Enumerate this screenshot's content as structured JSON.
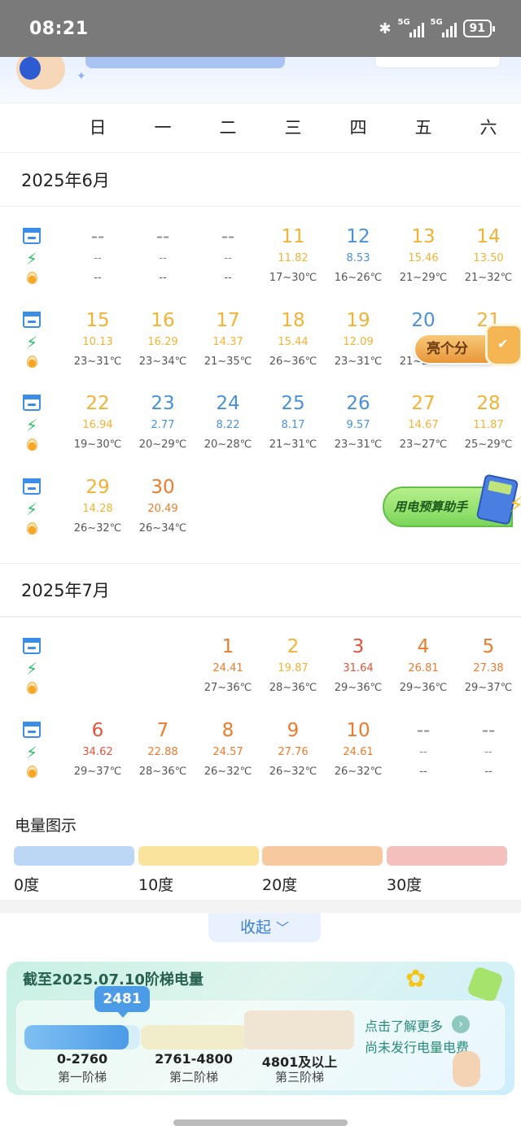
{
  "status_bar": {
    "time": "08:21",
    "network1": "5G",
    "network2": "5G",
    "battery": "91"
  },
  "weekdays": [
    "日",
    "一",
    "二",
    "三",
    "四",
    "五",
    "六"
  ],
  "months": [
    {
      "label": "2025年6月",
      "rows": [
        [
          null,
          {
            "day": "--",
            "value": "--",
            "temp": "--",
            "color": "gray"
          },
          {
            "day": "--",
            "value": "--",
            "temp": "--",
            "color": "gray"
          },
          {
            "day": "--",
            "value": "--",
            "temp": "--",
            "color": "gray"
          },
          {
            "day": "11",
            "value": "11.82",
            "temp": "17~30℃",
            "color": "yellow"
          },
          {
            "day": "12",
            "value": "8.53",
            "temp": "16~26℃",
            "color": "blue"
          },
          {
            "day": "13",
            "value": "15.46",
            "temp": "21~29℃",
            "color": "yellow"
          },
          {
            "day": "14",
            "value": "13.50",
            "temp": "21~32℃",
            "color": "yellow"
          }
        ],
        [
          null,
          {
            "day": "15",
            "value": "10.13",
            "temp": "23~31℃",
            "color": "yellow"
          },
          {
            "day": "16",
            "value": "16.29",
            "temp": "23~34℃",
            "color": "yellow"
          },
          {
            "day": "17",
            "value": "14.37",
            "temp": "21~35℃",
            "color": "yellow"
          },
          {
            "day": "18",
            "value": "15.44",
            "temp": "26~36℃",
            "color": "yellow"
          },
          {
            "day": "19",
            "value": "12.09",
            "temp": "23~31℃",
            "color": "yellow"
          },
          {
            "day": "20",
            "value": "",
            "temp": "21~26℃",
            "color": "blue"
          },
          {
            "day": "21",
            "value": "",
            "temp": "",
            "color": "yellow"
          }
        ],
        [
          null,
          {
            "day": "22",
            "value": "16.94",
            "temp": "19~30℃",
            "color": "yellow"
          },
          {
            "day": "23",
            "value": "2.77",
            "temp": "20~29℃",
            "color": "blue"
          },
          {
            "day": "24",
            "value": "8.22",
            "temp": "20~28℃",
            "color": "blue"
          },
          {
            "day": "25",
            "value": "8.17",
            "temp": "21~31℃",
            "color": "blue"
          },
          {
            "day": "26",
            "value": "9.57",
            "temp": "23~31℃",
            "color": "blue"
          },
          {
            "day": "27",
            "value": "14.67",
            "temp": "23~27℃",
            "color": "yellow"
          },
          {
            "day": "28",
            "value": "11.87",
            "temp": "25~29℃",
            "color": "yellow"
          }
        ],
        [
          null,
          {
            "day": "29",
            "value": "14.28",
            "temp": "26~32℃",
            "color": "yellow"
          },
          {
            "day": "30",
            "value": "20.49",
            "temp": "26~34℃",
            "color": "orange"
          },
          null,
          null,
          null,
          null,
          null
        ]
      ]
    },
    {
      "label": "2025年7月",
      "rows": [
        [
          null,
          null,
          null,
          {
            "day": "1",
            "value": "24.41",
            "temp": "27~36℃",
            "color": "orange"
          },
          {
            "day": "2",
            "value": "19.87",
            "temp": "28~36℃",
            "color": "yellow"
          },
          {
            "day": "3",
            "value": "31.64",
            "temp": "29~36℃",
            "color": "red"
          },
          {
            "day": "4",
            "value": "26.81",
            "temp": "29~36℃",
            "color": "orange"
          },
          {
            "day": "5",
            "value": "27.38",
            "temp": "29~37℃",
            "color": "orange"
          }
        ],
        [
          null,
          {
            "day": "6",
            "value": "34.62",
            "temp": "29~37℃",
            "color": "red"
          },
          {
            "day": "7",
            "value": "22.88",
            "temp": "28~36℃",
            "color": "orange"
          },
          {
            "day": "8",
            "value": "24.57",
            "temp": "26~32℃",
            "color": "orange"
          },
          {
            "day": "9",
            "value": "27.76",
            "temp": "26~32℃",
            "color": "orange"
          },
          {
            "day": "10",
            "value": "24.61",
            "temp": "26~32℃",
            "color": "orange"
          },
          {
            "day": "--",
            "value": "--",
            "temp": "--",
            "color": "gray"
          },
          {
            "day": "--",
            "value": "--",
            "temp": "--",
            "color": "gray"
          }
        ]
      ]
    }
  ],
  "badges": {
    "liang": "亮个分",
    "budget": "用电预算助手"
  },
  "legend": {
    "title": "电量图示",
    "items": [
      {
        "label": "0度",
        "color": "#bcd6f5"
      },
      {
        "label": "10度",
        "color": "#fae39c"
      },
      {
        "label": "20度",
        "color": "#f6c99e"
      },
      {
        "label": "30度",
        "color": "#f4c0bd"
      }
    ]
  },
  "collapse": {
    "label": "收起",
    "icon": "chevron-down-icon"
  },
  "tier": {
    "title": "截至2025.07.10阶梯电量",
    "current": "2481",
    "current_fraction_of_tier1": 0.9,
    "tiers": [
      {
        "range": "0-2760",
        "name": "第一阶梯"
      },
      {
        "range": "2761-4800",
        "name": "第二阶梯"
      },
      {
        "range": "4801及以上",
        "name": "第三阶梯"
      }
    ],
    "link1": "点击了解更多",
    "link2": "尚未发行电量电费"
  },
  "colors": {
    "blue": "#4a90d9",
    "yellow": "#f2b234",
    "orange": "#ec7b2c",
    "red": "#e2533b",
    "gray": "#888888"
  }
}
